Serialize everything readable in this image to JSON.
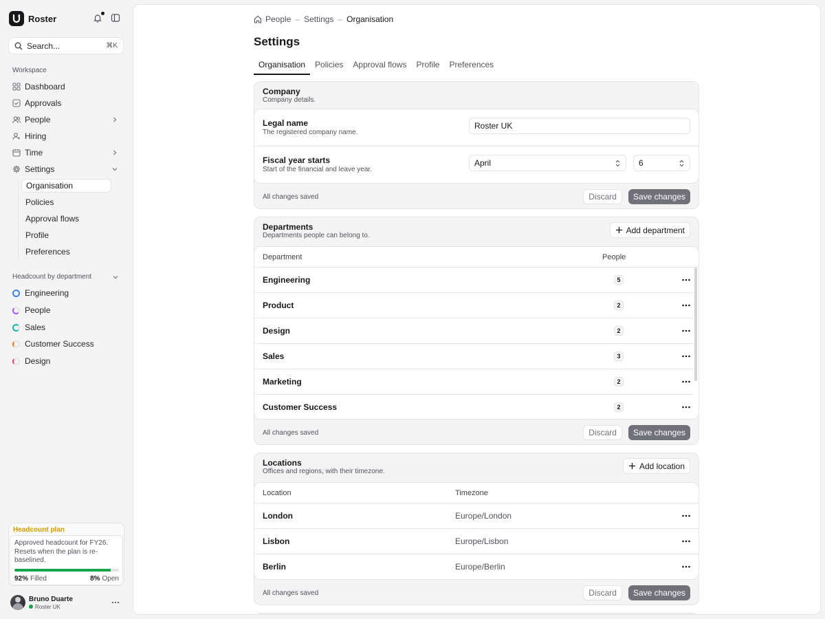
{
  "app": {
    "name": "Roster"
  },
  "search": {
    "placeholder": "Search...",
    "shortcut": "⌘K"
  },
  "sidebar": {
    "workspace_label": "Workspace",
    "items": [
      {
        "label": "Dashboard",
        "icon": "grid-icon"
      },
      {
        "label": "Approvals",
        "icon": "check-square-icon"
      },
      {
        "label": "People",
        "icon": "users-icon",
        "chevron": "right"
      },
      {
        "label": "Hiring",
        "icon": "user-plus-icon"
      },
      {
        "label": "Time",
        "icon": "calendar-icon",
        "chevron": "right"
      },
      {
        "label": "Settings",
        "icon": "gear-icon",
        "chevron": "down"
      }
    ],
    "settings_sub": [
      "Organisation",
      "Policies",
      "Approval flows",
      "Profile",
      "Preferences"
    ],
    "settings_active": "Organisation",
    "headcount_label": "Headcount by department",
    "headcount": [
      {
        "label": "Engineering",
        "color": "#3b82f6"
      },
      {
        "label": "People",
        "color": "#a855f7"
      },
      {
        "label": "Sales",
        "color": "#14b8a6"
      },
      {
        "label": "Customer Success",
        "color": "#f97316"
      },
      {
        "label": "Design",
        "color": "#f43f5e"
      }
    ]
  },
  "plan": {
    "title": "Headcount plan",
    "description": "Approved headcount for FY26. Resets when the plan is re-baselined.",
    "filled_pct": "92%",
    "filled_label": "Filled",
    "open_pct": "8%",
    "open_label": "Open",
    "filled_fraction": 0.92,
    "accent": "#16a34a"
  },
  "user": {
    "name": "Bruno Duarte",
    "org": "Roster UK"
  },
  "breadcrumb": [
    "People",
    "Settings",
    "Organisation"
  ],
  "page": {
    "title": "Settings"
  },
  "tabs": [
    "Organisation",
    "Policies",
    "Approval flows",
    "Profile",
    "Preferences"
  ],
  "company": {
    "title": "Company",
    "subtitle": "Company details.",
    "legal_label": "Legal name",
    "legal_help": "The registered company name.",
    "legal_value": "Roster UK",
    "fiscal_label": "Fiscal year starts",
    "fiscal_help": "Start of the financial and leave year.",
    "fiscal_month": "April",
    "fiscal_day": "6",
    "status": "All changes saved",
    "discard": "Discard",
    "save": "Save changes"
  },
  "departments": {
    "title": "Departments",
    "subtitle": "Departments people can belong to.",
    "add_label": "Add department",
    "col_department": "Department",
    "col_people": "People",
    "rows": [
      {
        "name": "Engineering",
        "people": "5"
      },
      {
        "name": "Product",
        "people": "2"
      },
      {
        "name": "Design",
        "people": "2"
      },
      {
        "name": "Sales",
        "people": "3"
      },
      {
        "name": "Marketing",
        "people": "2"
      },
      {
        "name": "Customer Success",
        "people": "2"
      }
    ],
    "status": "All changes saved",
    "discard": "Discard",
    "save": "Save changes"
  },
  "locations": {
    "title": "Locations",
    "subtitle": "Offices and regions, with their timezone.",
    "add_label": "Add location",
    "col_location": "Location",
    "col_timezone": "Timezone",
    "rows": [
      {
        "name": "London",
        "timezone": "Europe/London"
      },
      {
        "name": "Lisbon",
        "timezone": "Europe/Lisbon"
      },
      {
        "name": "Berlin",
        "timezone": "Europe/Berlin"
      }
    ],
    "status": "All changes saved",
    "discard": "Discard",
    "save": "Save changes"
  }
}
